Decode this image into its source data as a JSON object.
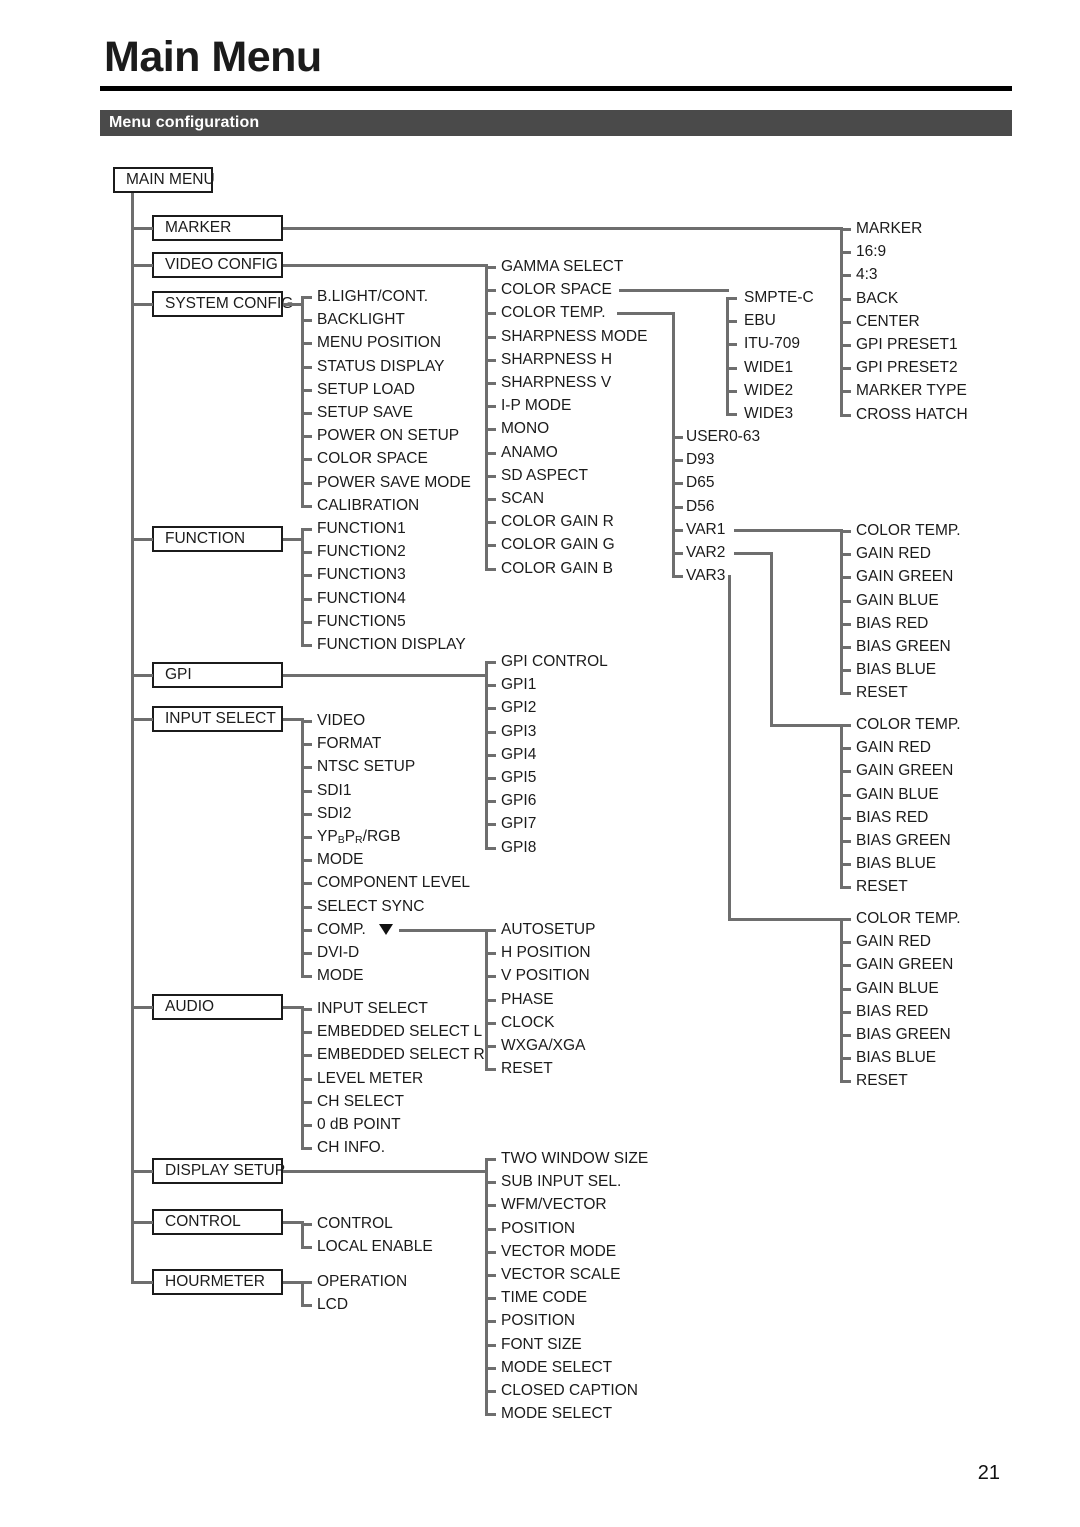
{
  "page": {
    "title": "Main Menu",
    "section": "Menu configuration",
    "number": "21"
  },
  "diagram": {
    "root": "MAIN MENU",
    "top_level": [
      "MARKER",
      "VIDEO CONFIG",
      "SYSTEM CONFIG",
      "FUNCTION",
      "GPI",
      "INPUT SELECT",
      "AUDIO",
      "DISPLAY SETUP",
      "CONTROL",
      "HOURMETER"
    ],
    "marker_items": [
      "MARKER",
      "16:9",
      "4:3",
      "BACK",
      "CENTER",
      "GPI PRESET1",
      "GPI PRESET2",
      "MARKER TYPE",
      "CROSS HATCH"
    ],
    "video_config_items": [
      "GAMMA SELECT",
      "COLOR SPACE",
      "COLOR TEMP.",
      "SHARPNESS MODE",
      "SHARPNESS H",
      "SHARPNESS V",
      "I-P MODE",
      "MONO",
      "ANAMO",
      "SD ASPECT",
      "SCAN",
      "COLOR GAIN R",
      "COLOR GAIN G",
      "COLOR GAIN B"
    ],
    "color_space_items": [
      "SMPTE-C",
      "EBU",
      "ITU-709",
      "WIDE1",
      "WIDE2",
      "WIDE3"
    ],
    "color_temp_items": [
      "USER0-63",
      "D93",
      "D65",
      "D56",
      "VAR1",
      "VAR2",
      "VAR3"
    ],
    "var_detail_items": [
      "COLOR TEMP.",
      "GAIN RED",
      "GAIN GREEN",
      "GAIN BLUE",
      "BIAS RED",
      "BIAS GREEN",
      "BIAS BLUE",
      "RESET"
    ],
    "system_config_items": [
      "B.LIGHT/CONT.",
      "BACKLIGHT",
      "MENU POSITION",
      "STATUS DISPLAY",
      "SETUP LOAD",
      "SETUP SAVE",
      "POWER ON SETUP",
      "COLOR SPACE",
      "POWER SAVE MODE",
      "CALIBRATION"
    ],
    "function_items": [
      "FUNCTION1",
      "FUNCTION2",
      "FUNCTION3",
      "FUNCTION4",
      "FUNCTION5",
      "FUNCTION DISPLAY"
    ],
    "gpi_items": [
      "GPI CONTROL",
      "GPI1",
      "GPI2",
      "GPI3",
      "GPI4",
      "GPI5",
      "GPI6",
      "GPI7",
      "GPI8"
    ],
    "input_select_items": [
      "VIDEO",
      "FORMAT",
      "NTSC SETUP",
      "SDI1",
      "SDI2",
      "YPBPR/RGB",
      "MODE",
      "COMPONENT LEVEL",
      "SELECT SYNC",
      "COMP.",
      "DVI-D",
      "MODE"
    ],
    "comp_items": [
      "AUTOSETUP",
      "H POSITION",
      "V POSITION",
      "PHASE",
      "CLOCK",
      "WXGA/XGA",
      "RESET"
    ],
    "audio_items": [
      "INPUT SELECT",
      "EMBEDDED SELECT L",
      "EMBEDDED SELECT R",
      "LEVEL METER",
      "CH SELECT",
      "0 dB POINT",
      "CH INFO."
    ],
    "display_setup_items": [
      "TWO WINDOW SIZE",
      "SUB INPUT SEL.",
      "WFM/VECTOR",
      "POSITION",
      "VECTOR MODE",
      "VECTOR SCALE",
      "TIME CODE",
      "POSITION",
      "FONT SIZE",
      "MODE SELECT",
      "CLOSED CAPTION",
      "MODE SELECT"
    ],
    "control_items": [
      "CONTROL",
      "LOCAL ENABLE"
    ],
    "hourmeter_items": [
      "OPERATION",
      "LCD"
    ],
    "icons": {
      "comp_dropdown": "triangle-down-icon"
    },
    "colors": {
      "line": "#6e6e6e",
      "box_border": "#1b1b1b",
      "section_bar": "#4a4a4a",
      "text": "#1b1b1b"
    }
  }
}
